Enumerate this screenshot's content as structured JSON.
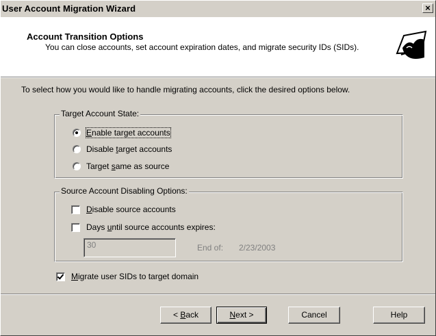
{
  "window": {
    "title": "User Account Migration Wizard",
    "close_glyph": "×"
  },
  "header": {
    "title": "Account Transition Options",
    "description": "You can close accounts, set account expiration dates, and migrate security IDs (SIDs).",
    "icon": "wizard-hand-icon"
  },
  "intro": "To select how you would like to handle migrating accounts, click the desired options below.",
  "target_state": {
    "legend": "Target Account State:",
    "options": [
      {
        "pre": "",
        "accel": "E",
        "post": "nable target accounts",
        "selected": true
      },
      {
        "pre": "Disable ",
        "accel": "t",
        "post": "arget accounts",
        "selected": false
      },
      {
        "pre": "Target ",
        "accel": "s",
        "post": "ame as source",
        "selected": false
      }
    ]
  },
  "source_disabling": {
    "legend": "Source Account Disabling Options:",
    "disable_source": {
      "pre": "",
      "accel": "D",
      "post": "isable source accounts",
      "checked": false
    },
    "days_until_expire": {
      "pre": "Days ",
      "accel": "u",
      "post": "ntil source accounts expires:",
      "checked": false
    },
    "days_value": "30",
    "end_of_label": "End of:",
    "end_of_date": "2/23/2003"
  },
  "migrate_sids": {
    "pre": "",
    "accel": "M",
    "post": "igrate user SIDs to target domain",
    "checked": true
  },
  "buttons": {
    "back": {
      "pre": "< ",
      "accel": "B",
      "post": "ack"
    },
    "next": {
      "pre": "",
      "accel": "N",
      "post": "ext >"
    },
    "cancel": "Cancel",
    "help": "Help"
  }
}
